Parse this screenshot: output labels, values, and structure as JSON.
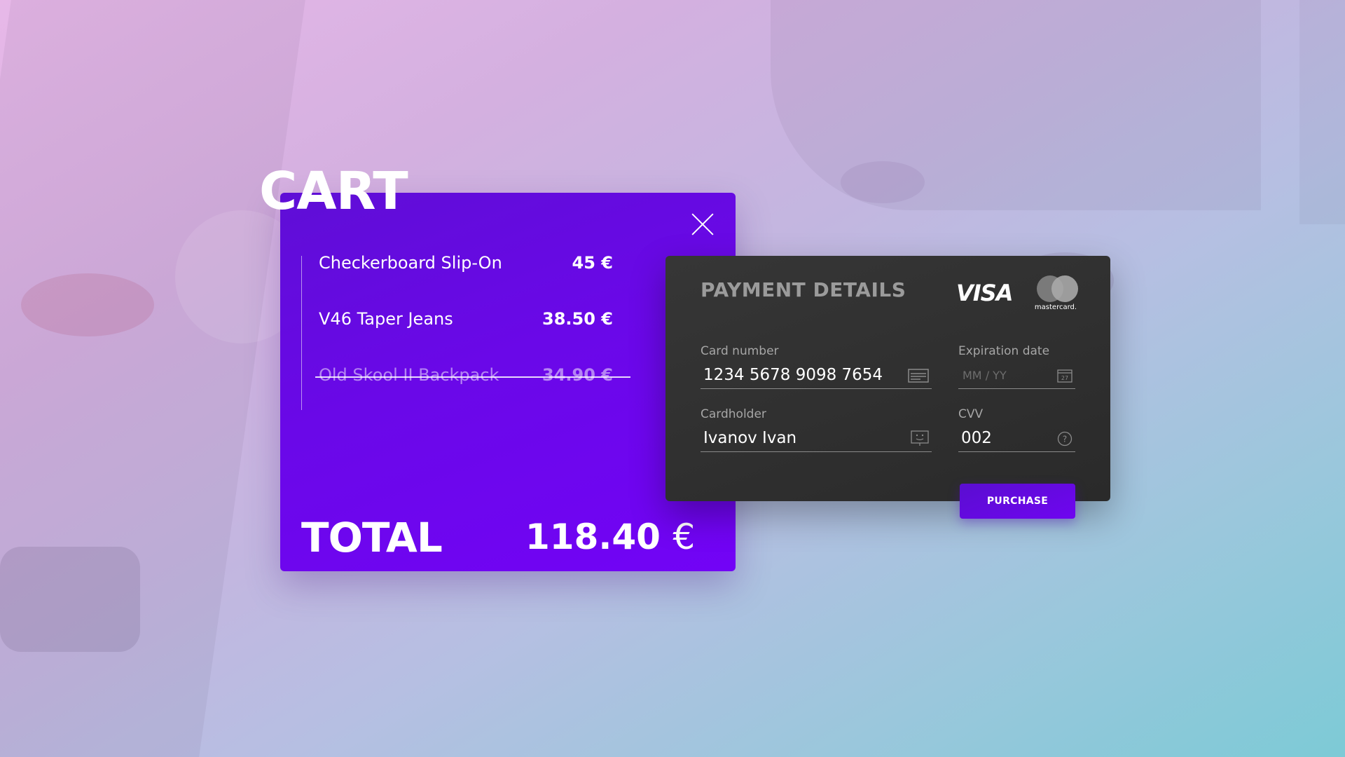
{
  "cart": {
    "title": "CART",
    "items": [
      {
        "name": "Checkerboard Slip-On",
        "price": "45 €",
        "remove": "×",
        "removed": false
      },
      {
        "name": "V46 Taper Jeans",
        "price": "38.50 €",
        "remove": "×",
        "removed": false
      },
      {
        "name": "Old Skool II Backpack",
        "price": "34.90 €",
        "remove": "×",
        "removed": true
      }
    ],
    "total_label": "TOTAL",
    "total_value": "118.40",
    "total_currency": "€"
  },
  "payment": {
    "title": "PAYMENT DETAILS",
    "visa": "VISA",
    "mastercard": "mastercard.",
    "card_number_label": "Card number",
    "card_number_value": "1234 5678 9098 7654",
    "expiration_label": "Expiration date",
    "expiration_placeholder": "MM / YY",
    "calendar_day": "27",
    "cardholder_label": "Cardholder",
    "cardholder_value": "Ivanov Ivan",
    "cvv_label": "CVV",
    "cvv_value": "002",
    "purchase_label": "PURCHASE"
  },
  "colors": {
    "cart_accent": "#6a08e8",
    "payment_bg": "#2e2e2e",
    "button": "#6305e0"
  },
  "icons": {
    "close": "close-icon",
    "card": "card-icon",
    "calendar": "calendar-icon",
    "person": "person-card-icon",
    "help": "help-icon"
  }
}
